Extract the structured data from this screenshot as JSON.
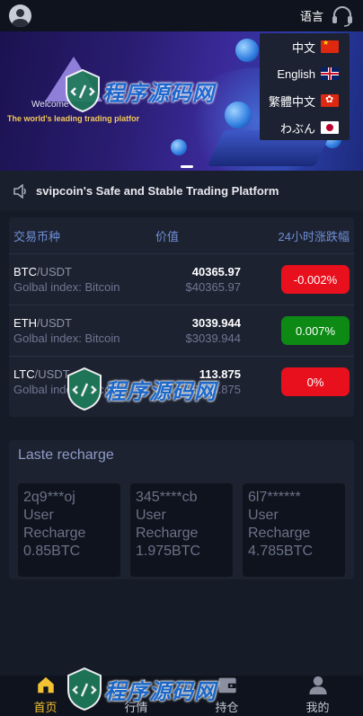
{
  "topbar": {
    "lang_label": "语言"
  },
  "banner": {
    "welcome": "Welcome",
    "tagline": "The world's leading trading platfor"
  },
  "lang_menu": [
    {
      "label": "中文",
      "flag": "cn-flag-icon"
    },
    {
      "label": "English",
      "flag": "uk-flag-icon"
    },
    {
      "label": "繁體中文",
      "flag": "hk-flag-icon"
    },
    {
      "label": "わぶん",
      "flag": "jp-flag-icon"
    }
  ],
  "notice": {
    "text": "svipcoin's Safe and Stable Trading Platform"
  },
  "market": {
    "headers": {
      "pair": "交易币种",
      "price": "价值",
      "change": "24小时涨跌幅"
    },
    "rows": [
      {
        "base": "BTC",
        "quote": "/USDT",
        "index": "Golbal index: Bitcoin",
        "price": "40365.97",
        "usd": "$40365.97",
        "change": "-0.002%",
        "trend": "down"
      },
      {
        "base": "ETH",
        "quote": "/USDT",
        "index": "Golbal index: Bitcoin",
        "price": "3039.944",
        "usd": "$3039.944",
        "change": "0.007%",
        "trend": "up"
      },
      {
        "base": "LTC",
        "quote": "/USDT",
        "index": "Golbal index: Bitcoin",
        "price": "113.875",
        "usd": "$113.875",
        "change": "0%",
        "trend": "down"
      }
    ]
  },
  "recharge": {
    "title": "Laste recharge",
    "cards": [
      {
        "user": "2q9***oj",
        "line1": "User",
        "line2": "Recharge",
        "amount": "0.85BTC"
      },
      {
        "user": "345****cb",
        "line1": "User",
        "line2": "Recharge",
        "amount": "1.975BTC"
      },
      {
        "user": "6l7******",
        "line1": "User",
        "line2": "Recharge",
        "amount": "4.785BTC"
      }
    ]
  },
  "watermark": {
    "text": "程序源码网"
  },
  "bottom_nav": [
    {
      "label": "首页",
      "icon": "home-icon",
      "active": true
    },
    {
      "label": "行情",
      "icon": "chart-icon",
      "active": false
    },
    {
      "label": "持仓",
      "icon": "wallet-icon",
      "active": false
    },
    {
      "label": "我的",
      "icon": "user-icon",
      "active": false
    }
  ],
  "colors": {
    "background": "#161b28",
    "active_nav": "#f1c232",
    "down": "#e8101d",
    "up": "#0c8a14",
    "accent_blue": "#6f8fd6"
  }
}
